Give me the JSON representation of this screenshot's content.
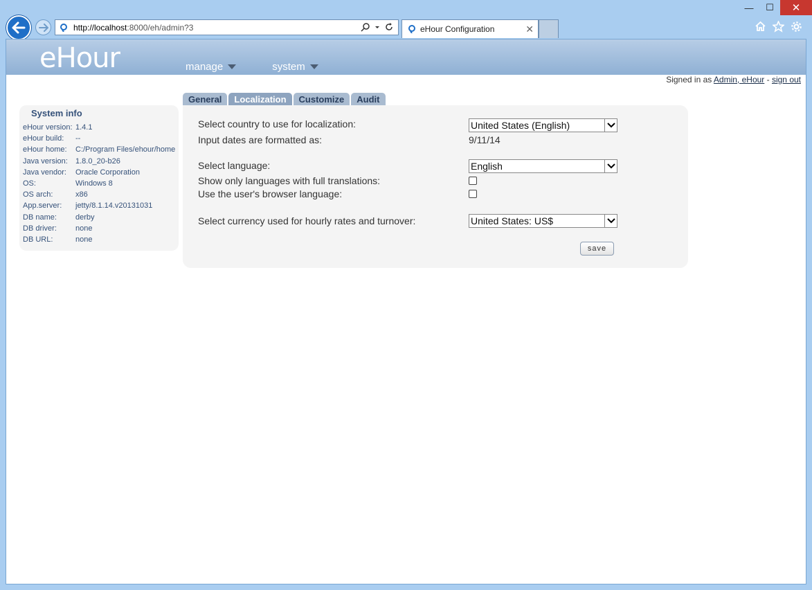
{
  "browser": {
    "url_host": "http://localhost",
    "url_rest": ":8000/eh/admin?3",
    "tab_title": "eHour Configuration",
    "win_minimize": "—",
    "win_maximize": "☐",
    "win_close": "✕",
    "tab_close": "✕"
  },
  "site": {
    "logo": "eHour",
    "nav": [
      {
        "label": "manage"
      },
      {
        "label": "system"
      }
    ],
    "signed_in_prefix": "Signed in as ",
    "signed_in_user": "Admin, eHour",
    "separator": " - ",
    "sign_out": "sign out"
  },
  "sysinfo": {
    "title": "System info",
    "rows": [
      {
        "key": "eHour version:",
        "value": "1.4.1"
      },
      {
        "key": "eHour build:",
        "value": "--"
      },
      {
        "key": "eHour home:",
        "value": "C:/Program Files/ehour/home"
      },
      {
        "key": "Java version:",
        "value": "1.8.0_20-b26"
      },
      {
        "key": "Java vendor:",
        "value": "Oracle Corporation"
      },
      {
        "key": "OS:",
        "value": "Windows 8"
      },
      {
        "key": "OS arch:",
        "value": "x86"
      },
      {
        "key": "App.server:",
        "value": "jetty/8.1.14.v20131031"
      },
      {
        "key": "DB name:",
        "value": "derby"
      },
      {
        "key": "DB driver:",
        "value": "none"
      },
      {
        "key": "DB URL:",
        "value": "none"
      }
    ]
  },
  "tabs": [
    {
      "label": "General"
    },
    {
      "label": "Localization"
    },
    {
      "label": "Customize"
    },
    {
      "label": "Audit"
    }
  ],
  "config": {
    "country_label": "Select country to use for localization:",
    "country_value": "United States (English)",
    "dates_label": "Input dates are formatted as:",
    "dates_value": "9/11/14",
    "language_label": "Select language:",
    "language_value": "English",
    "full_translations_label": "Show only languages with full translations:",
    "full_translations_checked": false,
    "browser_lang_label": "Use the user's browser language:",
    "browser_lang_checked": false,
    "currency_label": "Select currency used for hourly rates and turnover:",
    "currency_value": "United States: US$",
    "save_label": "save"
  }
}
